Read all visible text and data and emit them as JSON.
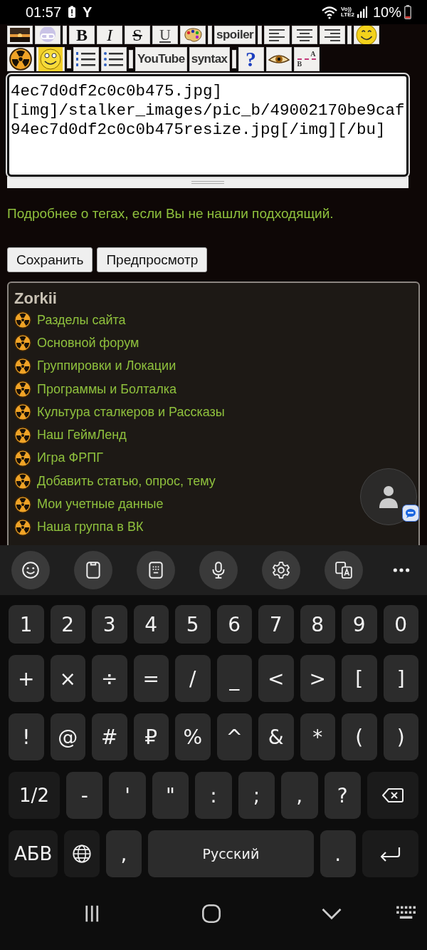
{
  "status_bar": {
    "time": "01:57",
    "app_glyph": "Y",
    "volte_label": "Vo))",
    "lte_label": "LTE2",
    "battery": "10%"
  },
  "toolbar": [
    [
      {
        "kind": "photo"
      },
      {
        "kind": "link"
      },
      {
        "kind": "sep"
      },
      {
        "kind": "bold",
        "label": "B"
      },
      {
        "kind": "italic",
        "label": "I"
      },
      {
        "kind": "strike",
        "label": "S"
      },
      {
        "kind": "underline",
        "label": "U"
      },
      {
        "kind": "palette"
      },
      {
        "kind": "sep"
      },
      {
        "kind": "tag",
        "label": "spoiler"
      },
      {
        "kind": "sep"
      },
      {
        "kind": "align-left"
      },
      {
        "kind": "align-center"
      },
      {
        "kind": "align-right"
      },
      {
        "kind": "sep"
      },
      {
        "kind": "smiley"
      }
    ],
    [
      {
        "kind": "radiation"
      },
      {
        "kind": "grin"
      },
      {
        "kind": "sep"
      },
      {
        "kind": "ol"
      },
      {
        "kind": "ul"
      },
      {
        "kind": "sep"
      },
      {
        "kind": "tag",
        "label": "YouTube"
      },
      {
        "kind": "tag",
        "label": "syntax"
      },
      {
        "kind": "sep"
      },
      {
        "kind": "help",
        "label": "?"
      },
      {
        "kind": "eye"
      },
      {
        "kind": "pair",
        "top": "A",
        "bottom": "B"
      }
    ]
  ],
  "editor": {
    "value": "4ec7d0df2c0c0b475.jpg]\n[img]/stalker_images/pic_b/49002170be9caf\n94ec7d0df2c0c0b475resize.jpg[/img][/bu]"
  },
  "tags_link": "Подробнее о тегах, если Вы не нашли подходящий.",
  "buttons": [
    "Сохранить",
    "Предпросмотр"
  ],
  "menu": {
    "title": "Zorkii",
    "items": [
      "Разделы сайта",
      "Основной форум",
      "Группировки и Локации",
      "Программы и Болталка",
      "Культура сталкеров и Рассказы",
      "Наш ГеймЛенд",
      "Игра ФРПГ",
      "Добавить статью, опрос, тему",
      "Мои учетные данные",
      "Наша группа в ВК"
    ]
  },
  "keyboard": {
    "tools": [
      {
        "kind": "emoji"
      },
      {
        "kind": "clipboard"
      },
      {
        "kind": "keypad"
      },
      {
        "kind": "mic"
      },
      {
        "kind": "settings"
      },
      {
        "kind": "translate"
      },
      {
        "kind": "more"
      }
    ],
    "rows": [
      {
        "keys": [
          {
            "kind": "char",
            "label": "1"
          },
          {
            "kind": "char",
            "label": "2"
          },
          {
            "kind": "char",
            "label": "3"
          },
          {
            "kind": "char",
            "label": "4"
          },
          {
            "kind": "char",
            "label": "5"
          },
          {
            "kind": "char",
            "label": "6"
          },
          {
            "kind": "char",
            "label": "7"
          },
          {
            "kind": "char",
            "label": "8"
          },
          {
            "kind": "char",
            "label": "9"
          },
          {
            "kind": "char",
            "label": "0"
          }
        ]
      },
      {
        "keys": [
          {
            "kind": "char",
            "label": "+"
          },
          {
            "kind": "char",
            "label": "×"
          },
          {
            "kind": "char",
            "label": "÷"
          },
          {
            "kind": "char",
            "label": "="
          },
          {
            "kind": "char",
            "label": "/"
          },
          {
            "kind": "char",
            "label": "_"
          },
          {
            "kind": "char",
            "label": "<"
          },
          {
            "kind": "char",
            "label": ">"
          },
          {
            "kind": "char",
            "label": "["
          },
          {
            "kind": "char",
            "label": "]"
          }
        ]
      },
      {
        "keys": [
          {
            "kind": "char",
            "label": "!"
          },
          {
            "kind": "char",
            "label": "@"
          },
          {
            "kind": "char",
            "label": "#"
          },
          {
            "kind": "char",
            "label": "₽"
          },
          {
            "kind": "char",
            "label": "%"
          },
          {
            "kind": "char",
            "label": "^"
          },
          {
            "kind": "char",
            "label": "&"
          },
          {
            "kind": "char",
            "label": "*"
          },
          {
            "kind": "char",
            "label": "("
          },
          {
            "kind": "char",
            "label": ")"
          }
        ]
      },
      {
        "keys": [
          {
            "kind": "wide",
            "label": "1/2"
          },
          {
            "kind": "char",
            "label": "-"
          },
          {
            "kind": "char",
            "label": "'"
          },
          {
            "kind": "char",
            "label": "\""
          },
          {
            "kind": "char",
            "label": ":"
          },
          {
            "kind": "char",
            "label": ";"
          },
          {
            "kind": "char",
            "label": ","
          },
          {
            "kind": "char",
            "label": "?"
          },
          {
            "kind": "backspace"
          }
        ]
      },
      {
        "keys": [
          {
            "kind": "wide",
            "label": "АБВ"
          },
          {
            "kind": "globe"
          },
          {
            "kind": "char",
            "label": ","
          },
          {
            "kind": "space",
            "label": "Русский"
          },
          {
            "kind": "char",
            "label": "."
          },
          {
            "kind": "enter"
          }
        ]
      }
    ]
  },
  "nav_bar": [
    {
      "kind": "recents"
    },
    {
      "kind": "home"
    },
    {
      "kind": "back"
    },
    {
      "kind": "keyboard"
    }
  ]
}
